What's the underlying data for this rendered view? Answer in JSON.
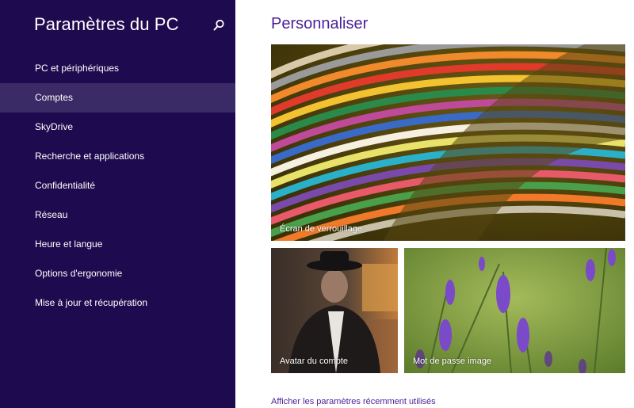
{
  "sidebar": {
    "title": "Paramètres du PC",
    "search_icon": "search-icon",
    "background": "#1e0a4e",
    "active_color": "#3a2a66",
    "items": [
      {
        "label": "PC et périphériques"
      },
      {
        "label": "Comptes",
        "active": true
      },
      {
        "label": "SkyDrive"
      },
      {
        "label": "Recherche et applications"
      },
      {
        "label": "Confidentialité"
      },
      {
        "label": "Réseau"
      },
      {
        "label": "Heure et langue"
      },
      {
        "label": "Options d'ergonomie"
      },
      {
        "label": "Mise à jour et récupération"
      }
    ]
  },
  "main": {
    "title": "Personnaliser",
    "accent": "#4a1f9a",
    "tiles": {
      "lock_screen": {
        "label": "Écran de verrouillage"
      },
      "account_avatar": {
        "label": "Avatar du compte"
      },
      "picture_password": {
        "label": "Mot de passe image"
      }
    },
    "recent_settings_link": "Afficher les paramètres récemment utilisés"
  }
}
